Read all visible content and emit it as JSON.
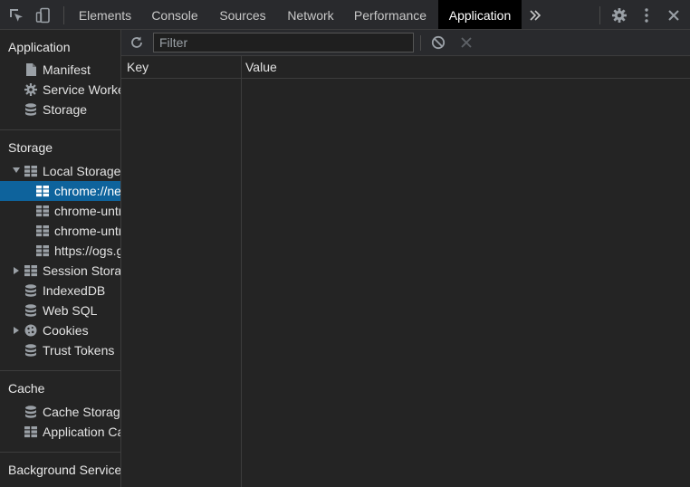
{
  "tabs": [
    {
      "label": "Elements"
    },
    {
      "label": "Console"
    },
    {
      "label": "Sources"
    },
    {
      "label": "Network"
    },
    {
      "label": "Performance"
    },
    {
      "label": "Application",
      "active": true
    }
  ],
  "tabbar_icons": [
    "inspect-element-icon",
    "device-toolbar-icon",
    "more-tabs-chevron-icon",
    "settings-gear-icon",
    "kebab-menu-icon",
    "close-icon"
  ],
  "sidebar": {
    "application": {
      "title": "Application",
      "items": [
        {
          "label": "Manifest",
          "icon": "document-icon"
        },
        {
          "label": "Service Workers",
          "icon": "gear-icon"
        },
        {
          "label": "Storage",
          "icon": "database-icon"
        }
      ]
    },
    "storage": {
      "title": "Storage",
      "local_storage": {
        "label": "Local Storage",
        "expanded": true
      },
      "local_children": [
        {
          "label": "chrome://new-tab-page",
          "selected": true
        },
        {
          "label": "chrome-untrusted://new-tab-page"
        },
        {
          "label": "chrome-untrusted://new-tab-page"
        },
        {
          "label": "https://ogs.google.com"
        }
      ],
      "session_storage": {
        "label": "Session Storage"
      },
      "indexeddb": {
        "label": "IndexedDB"
      },
      "websql": {
        "label": "Web SQL"
      },
      "cookies": {
        "label": "Cookies"
      },
      "trust_tokens": {
        "label": "Trust Tokens"
      }
    },
    "cache": {
      "title": "Cache",
      "items": [
        {
          "label": "Cache Storage",
          "icon": "database-icon"
        },
        {
          "label": "Application Cache",
          "icon": "grid-icon"
        }
      ]
    },
    "background": {
      "title": "Background Services"
    }
  },
  "toolbar": {
    "filter_placeholder": "Filter",
    "filter_value": ""
  },
  "table": {
    "columns": [
      "Key",
      "Value"
    ],
    "rows": []
  },
  "colors": {
    "selected": "#0e639c",
    "active_tab_bg": "#000000",
    "panel_bg": "#242424"
  }
}
